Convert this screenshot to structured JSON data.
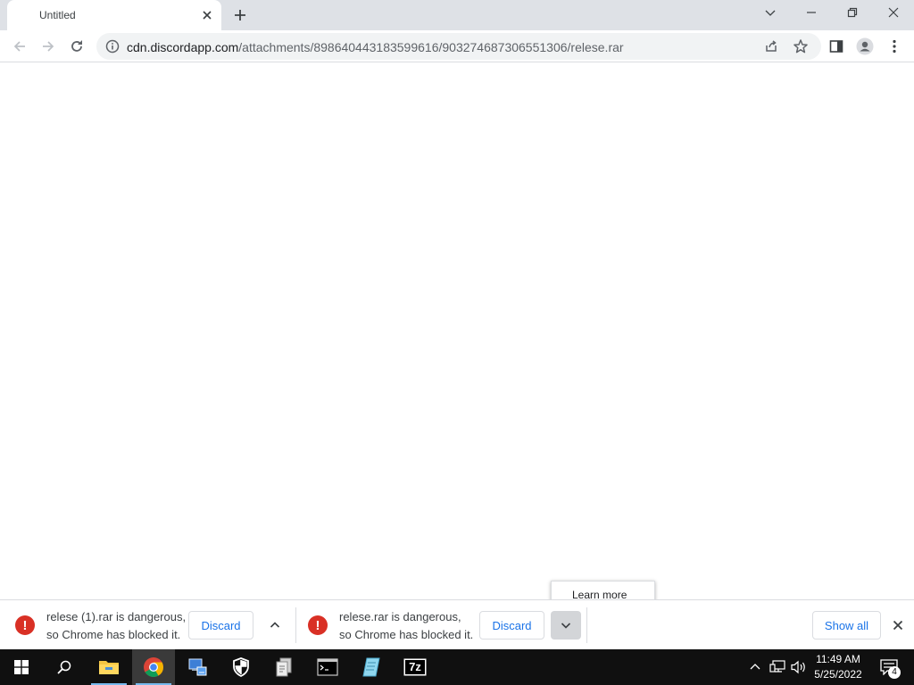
{
  "browser": {
    "tab": {
      "title": "Untitled"
    },
    "address_bar": {
      "host": "cdn.discordapp.com",
      "path": "/attachments/898640443183599616/903274687306551306/relese.rar"
    }
  },
  "download_shelf": {
    "items": [
      {
        "line1": "relese (1).rar is dangerous,",
        "line2": "so Chrome has blocked it.",
        "discard_label": "Discard",
        "status": "dangerous"
      },
      {
        "line1": "relese.rar is dangerous,",
        "line2": "so Chrome has blocked it.",
        "discard_label": "Discard",
        "status": "dangerous"
      }
    ],
    "show_all_label": "Show all",
    "context_menu": {
      "learn_more_label": "Learn more"
    }
  },
  "taskbar": {
    "apps": [
      "file-explorer",
      "chrome",
      "network-app",
      "security-shield",
      "document-app",
      "command-prompt",
      "notepad",
      "7-zip"
    ],
    "seven_zip_label": "7z",
    "clock": {
      "time": "11:49 AM",
      "date": "5/25/2022"
    },
    "notification_count": "4"
  },
  "colors": {
    "accent": "#1a73e8",
    "danger": "#d93025",
    "taskbar": "#101010",
    "tabstrip": "#dee1e6"
  }
}
